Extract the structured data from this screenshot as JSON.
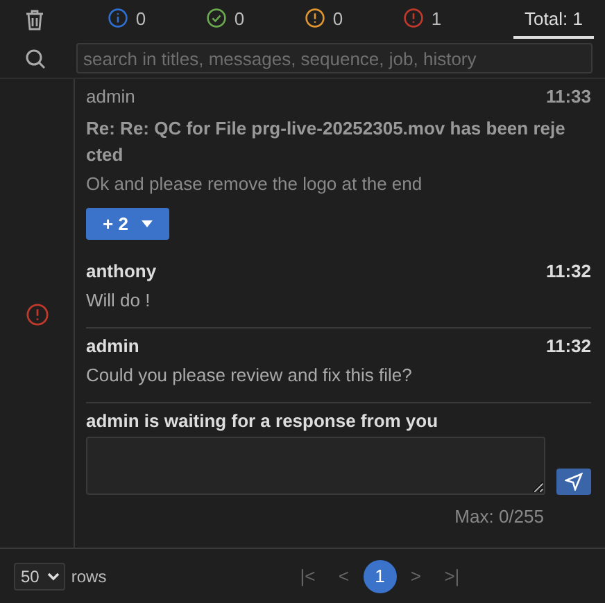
{
  "tabs": [
    {
      "kind": "info",
      "count": "0",
      "color": "#2f6fd0",
      "selected": false
    },
    {
      "kind": "success",
      "count": "0",
      "color": "#6aa84f",
      "selected": false
    },
    {
      "kind": "warning",
      "count": "0",
      "color": "#e0962f",
      "selected": false
    },
    {
      "kind": "error",
      "count": "1",
      "color": "#c0392b",
      "selected": false
    },
    {
      "kind": "total",
      "label": "Total: 1",
      "selected": true
    }
  ],
  "search": {
    "placeholder": "search in titles, messages, sequence, job, history"
  },
  "thread": {
    "kind": "error",
    "messages": [
      {
        "author": "admin",
        "time": "11:33",
        "subject": "Re: Re: QC for File prg-live-20252305.mov has been reje cted",
        "body": "Ok and please remove the logo at the end",
        "dimmed": true,
        "more": "+ 2"
      },
      {
        "author": "anthony",
        "time": "11:32",
        "body": "Will do !",
        "dimmed": false
      },
      {
        "author": "admin",
        "time": "11:32",
        "body": "Could you please review and fix this file?",
        "dimmed": false
      }
    ],
    "reply": {
      "prompt": "admin is waiting for a response from you",
      "counter": "Max: 0/255"
    }
  },
  "footer": {
    "page_size": "50",
    "rows_label": "rows",
    "first": "|<",
    "prev": "<",
    "pages": [
      {
        "label": "1",
        "selected": true
      }
    ],
    "next": ">",
    "last": ">|"
  }
}
